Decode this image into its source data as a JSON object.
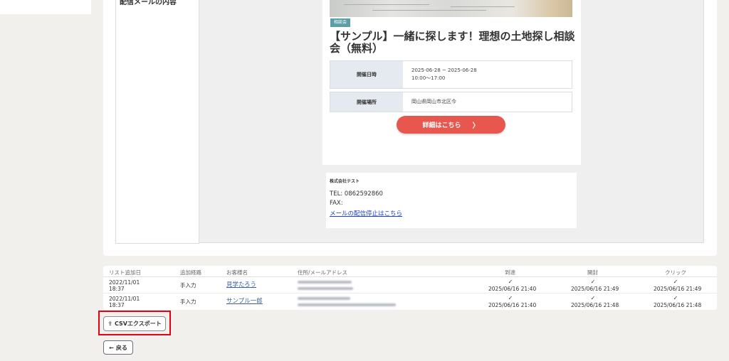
{
  "form": {
    "mail_content_label": "配信メールの内容"
  },
  "preview": {
    "tag": "相談会",
    "title": "【サンプル】一緒に探します！理想の土地探し相談会（無料）",
    "rows": [
      {
        "label": "開催日時",
        "line1": "2025-06-28 ~ 2025-06-28",
        "line2": "10:00〜17:00"
      },
      {
        "label": "開催場所",
        "line1": "岡山県岡山市北区今",
        "line2": ""
      }
    ],
    "detail_button": "詳細はこちら",
    "detail_chevron": "〉",
    "company": "株式会社テスト",
    "tel": "TEL: 0862592860",
    "fax": "FAX:",
    "unsubscribe": "メールの配信停止はこちら"
  },
  "table": {
    "headers": [
      "リスト追加日",
      "追加経路",
      "お客様名",
      "住所/メールアドレス",
      "到達",
      "開封",
      "クリック"
    ],
    "rows": [
      {
        "date1": "2022/11/01",
        "date2": "18:37",
        "route": "手入力",
        "name": "見学たろう",
        "reached": "2025/06/16 21:40",
        "opened": "2025/06/16 21:49",
        "clicked": "2025/06/16 21:49"
      },
      {
        "date1": "2022/11/01",
        "date2": "18:37",
        "route": "手入力",
        "name": "サンプル一郎",
        "reached": "2025/06/16 21:40",
        "opened": "2025/06/16 21:48",
        "clicked": "2025/06/16 21:48"
      }
    ],
    "check_glyph": "✓"
  },
  "actions": {
    "csv_icon": "⇪",
    "csv_export": "CSVエクスポート",
    "back_arrow": "←",
    "back": "戻る"
  },
  "icons": [
    "upload-icon",
    "arrow-left-icon",
    "check-icon",
    "chevron-right-icon"
  ],
  "colors": {
    "accent_button": "#e8574e",
    "tag": "#5b9ea8",
    "highlight_border": "#e60012",
    "link": "#1a3fd1"
  }
}
